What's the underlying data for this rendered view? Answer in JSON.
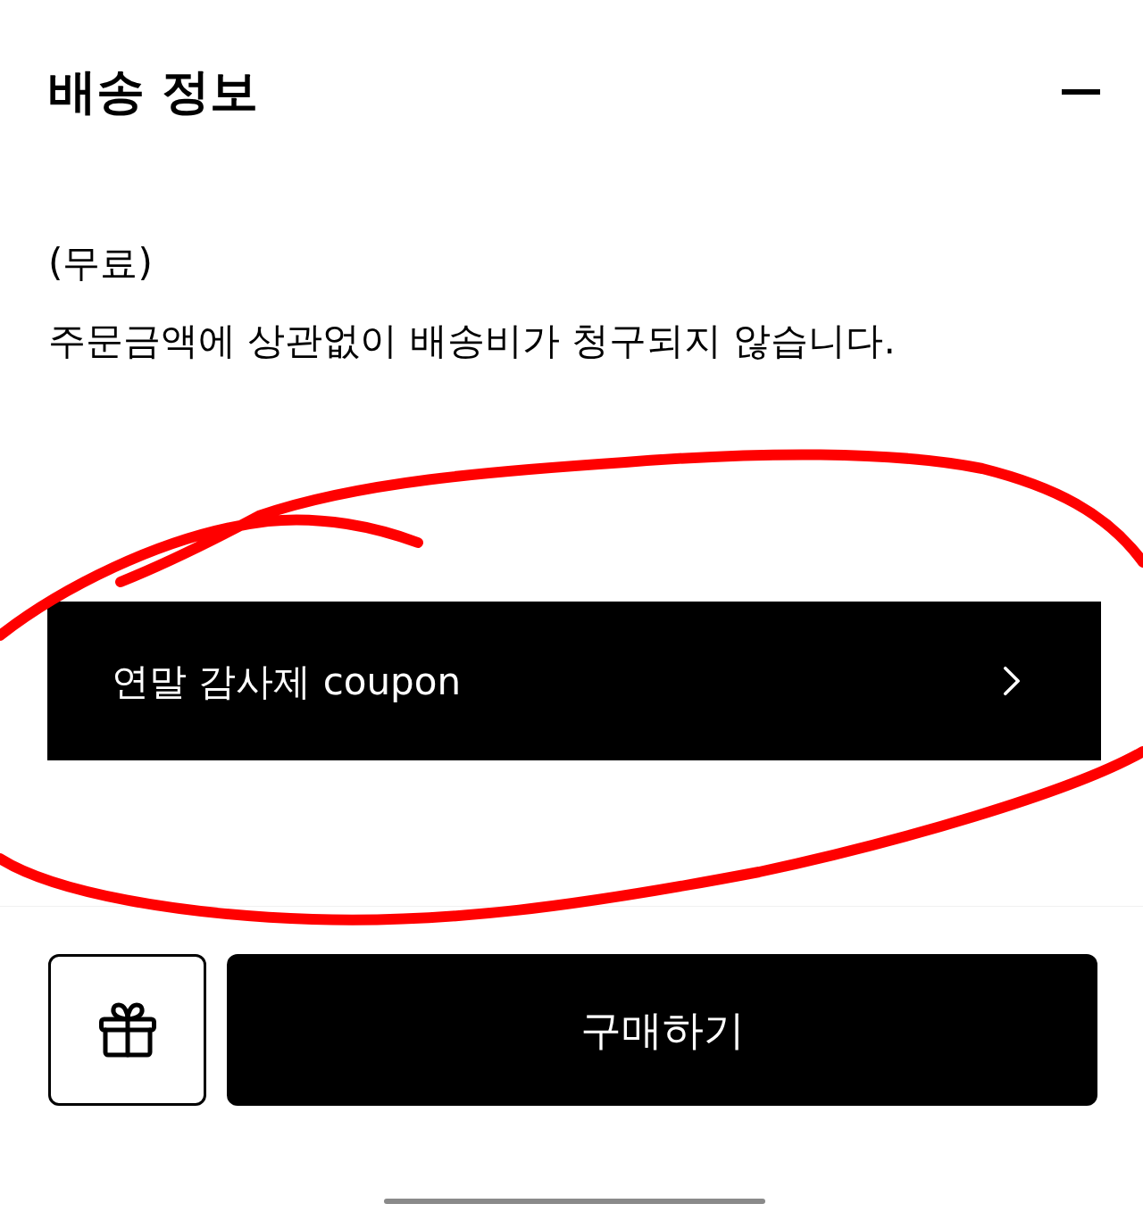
{
  "section": {
    "title": "배송 정보",
    "expanded": true
  },
  "shipping": {
    "fee_label": "(무료)",
    "description": "주문금액에 상관없이 배송비가 청구되지 않습니다."
  },
  "coupon_banner": {
    "label": "연말 감사제 coupon"
  },
  "bottom_bar": {
    "buy_button": "구매하기"
  }
}
